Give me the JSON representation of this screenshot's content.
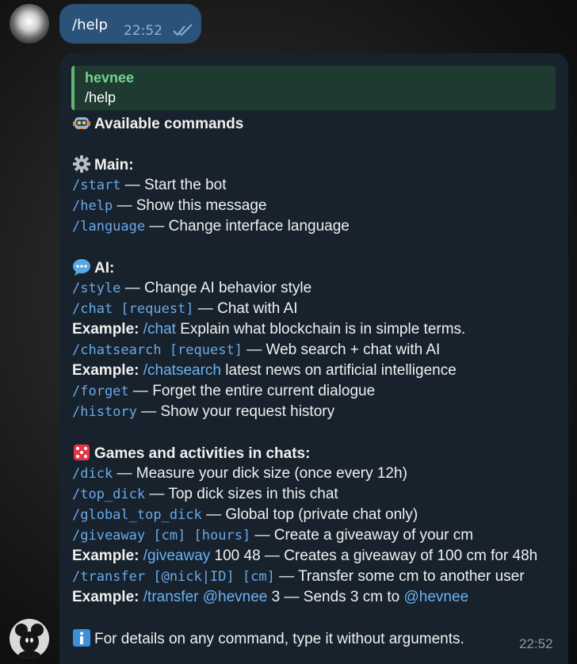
{
  "outgoing": {
    "text": "/help",
    "time": "22:52"
  },
  "incoming": {
    "reply_name": "hevnee",
    "reply_text": "/help",
    "time": "22:52",
    "title": "Available commands",
    "sections": {
      "main": {
        "heading": "Main:",
        "items": [
          {
            "cmd": "/start",
            "desc": " — Start the bot"
          },
          {
            "cmd": "/help",
            "desc": " — Show this message"
          },
          {
            "cmd": "/language",
            "desc": " — Change interface language"
          }
        ]
      },
      "ai": {
        "heading": "AI:",
        "style": {
          "cmd": "/style",
          "desc": " — Change AI behavior style"
        },
        "chat": {
          "cmd": "/chat [request]",
          "desc": " — Chat with AI"
        },
        "chat_example": {
          "label": "Example:",
          "cmd": "/chat",
          "desc": " Explain what blockchain is in simple terms."
        },
        "search": {
          "cmd": "/chatsearch [request]",
          "desc": " — Web search + chat with AI"
        },
        "search_example": {
          "label": "Example:",
          "cmd": "/chatsearch",
          "desc": " latest news on artificial intelligence"
        },
        "forget": {
          "cmd": "/forget",
          "desc": " — Forget the entire current dialogue"
        },
        "history": {
          "cmd": "/history",
          "desc": " — Show your request history"
        }
      },
      "games": {
        "heading": "Games and activities in chats:",
        "dick": {
          "cmd": "/dick",
          "desc": " — Measure your dick size (once every 12h)"
        },
        "top": {
          "cmd": "/top_dick",
          "desc": " — Top dick sizes in this chat"
        },
        "global": {
          "cmd": "/global_top_dick",
          "desc": " — Global top (private chat only)"
        },
        "giveaway": {
          "cmd": "/giveaway [cm] [hours]",
          "desc": " — Create a giveaway of your cm"
        },
        "giveaway_example": {
          "label": "Example:",
          "cmd": "/giveaway",
          "desc": " 100 48 — Creates a giveaway of 100 cm for 48h"
        },
        "transfer": {
          "cmd": "/transfer [@nick|ID] [cm]",
          "desc": " — Transfer some cm to another user"
        },
        "transfer_example": {
          "label": "Example:",
          "cmd": "/transfer",
          "mention1": "@hevnee",
          "desc": " 3 — Sends 3 cm to ",
          "mention2": "@hevnee"
        }
      }
    },
    "footer": "For details on any command, type it without arguments."
  },
  "icons": {
    "title": "robot-icon",
    "main": "gear-icon",
    "ai": "speech-bubble-icon",
    "games": "dice-icon",
    "footer": "info-icon",
    "read": "double-check-icon"
  },
  "colors": {
    "outgoing_bubble": "#2b5278",
    "incoming_bubble": "#17222c",
    "command": "#6aa9e8",
    "reply_accent": "#5eb86f"
  }
}
